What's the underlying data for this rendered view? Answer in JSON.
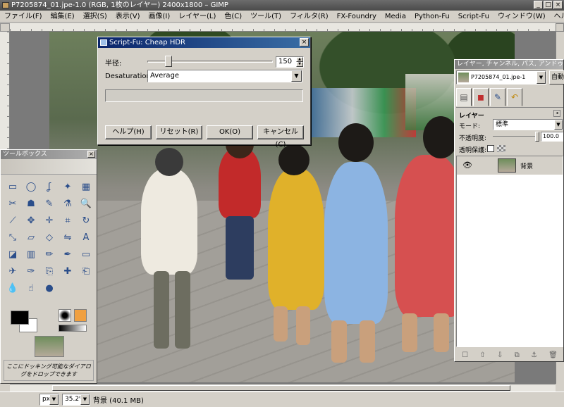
{
  "window": {
    "title": "P7205874_01.jpe-1.0 (RGB, 1枚のレイヤー) 2400x1800 – GIMP",
    "controls": [
      "_",
      "□",
      "×"
    ]
  },
  "menubar": {
    "items": [
      "ファイル(F)",
      "編集(E)",
      "選択(S)",
      "表示(V)",
      "画像(I)",
      "レイヤー(L)",
      "色(C)",
      "ツール(T)",
      "フィルタ(R)",
      "FX-Foundry",
      "Media",
      "Python-Fu",
      "Script-Fu",
      "ウィンドウ(W)",
      "ヘルプ(H)"
    ]
  },
  "dialog": {
    "title": "Script-Fu: Cheap HDR",
    "radius_label": "半径:",
    "radius_value": "150",
    "radius_slider_fraction": 0.15,
    "desat_label": "Desaturation:",
    "desat_value": "Average",
    "buttons": [
      "ヘルプ(H)",
      "リセット(R)",
      "OK(O)",
      "キャンセル(C)"
    ]
  },
  "toolbox": {
    "title": "ツールボックス",
    "icons": [
      "rect-select-icon",
      "ellipse-select-icon",
      "lasso-icon",
      "fuzzy-select-icon",
      "color-select-icon",
      "scissors-icon",
      "foreground-select-icon",
      "paths-icon",
      "color-picker-icon",
      "zoom-icon",
      "measure-icon",
      "move-icon",
      "align-icon",
      "crop-icon",
      "rotate-icon",
      "scale-icon",
      "shear-icon",
      "perspective-icon",
      "flip-icon",
      "text-icon",
      "bucket-fill-icon",
      "blend-icon",
      "pencil-icon",
      "paintbrush-icon",
      "eraser-icon",
      "airbrush-icon",
      "ink-icon",
      "clone-icon",
      "heal-icon",
      "perspective-clone-icon",
      "blur-icon",
      "smudge-icon",
      "dodge-burn-icon"
    ],
    "glyphs": [
      "▭",
      "◯",
      "ʆ",
      "✦",
      "▦",
      "✂",
      "☗",
      "✎",
      "⚗",
      "🔍",
      "⟋",
      "✥",
      "✛",
      "⌗",
      "↻",
      "⤡",
      "▱",
      "◇",
      "⇋",
      "A",
      "◪",
      "▥",
      "✏",
      "✒",
      "▭",
      "✈",
      "✑",
      "⎘",
      "✚",
      "⎗",
      "💧",
      "☝",
      "●"
    ],
    "drop_hint": "ここにドッキング可能なダイアログをドロップできます"
  },
  "layers": {
    "title": "レイヤー, チャンネル, パス, アンドゥ",
    "image_name": "P7205874_01.jpe-1",
    "auto_label": "自動",
    "tab_icons": [
      "layers-tab-icon",
      "channels-tab-icon",
      "paths-tab-icon",
      "undo-tab-icon"
    ],
    "tab_glyphs": [
      "▤",
      "◼",
      "✎",
      "↶"
    ],
    "heading": "レイヤー",
    "mode_label": "モード:",
    "mode_value": "標準",
    "opacity_label": "不透明度:",
    "opacity_value": "100.0",
    "lock_label": "透明保護:",
    "layer_name": "背景",
    "bottom_icons": [
      "new-layer-icon",
      "raise-layer-icon",
      "lower-layer-icon",
      "duplicate-layer-icon",
      "anchor-layer-icon",
      "delete-layer-icon"
    ],
    "bottom_glyphs": [
      "☐",
      "⇧",
      "⇩",
      "⧉",
      "⚓",
      "🗑"
    ]
  },
  "statusbar": {
    "unit": "px",
    "zoom": "35.2%",
    "info": "背景 (40.1 MB)"
  }
}
